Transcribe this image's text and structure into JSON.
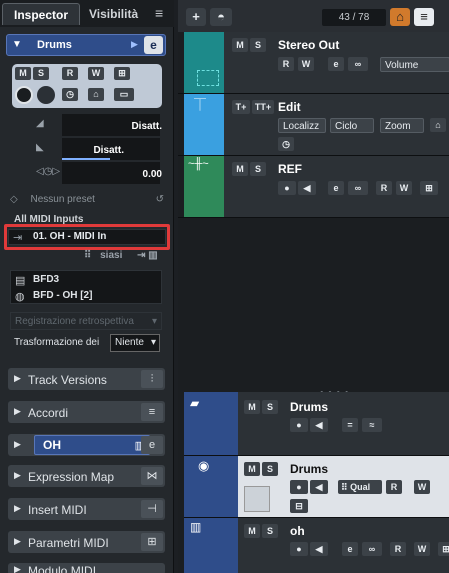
{
  "inspector": {
    "tab_inspector": "Inspector",
    "tab_visibility": "Visibilità",
    "menu_icon": "≡",
    "track_name": "Drums",
    "fader_left_value": "Disatt.",
    "fader_pan_value": "Disatt.",
    "fader_delay_value": "0.00",
    "preset": "Nessun preset",
    "midi_input": "All MIDI Inputs",
    "midi_output": "01. OH - MIDI In",
    "siasi": "siasi",
    "instrument": "BFD3",
    "instrument_program": "BFD - OH [2]",
    "retro_record": "Registrazione retrospettiva",
    "transform_label": "Trasformazione dei",
    "transform_value": "Niente",
    "sections": {
      "track_versions": "Track Versions",
      "chords": "Accordi",
      "oh_label": "OH",
      "expression_map": "Expression Map",
      "insert_midi": "Insert MIDI",
      "midi_params": "Parametri MIDI",
      "last": "Modulo MIDI"
    }
  },
  "project": {
    "counter": "43 / 78",
    "tracks": [
      {
        "name": "Stereo Out",
        "field": "Volume",
        "color": "#1d8a8a"
      },
      {
        "name": "Edit",
        "fields": [
          "Localizz",
          "Ciclo",
          "Zoom"
        ],
        "color": "#3aa0e0"
      },
      {
        "name": "REF",
        "color": "#2f8a5a"
      }
    ],
    "lower_tracks": [
      {
        "name": "Drums"
      },
      {
        "name": "Drums",
        "quality": "Qual"
      },
      {
        "name": "oh"
      }
    ]
  },
  "colors": {
    "accent_blue": "#2f4d8a",
    "highlight_red": "#e03a3a",
    "orange": "#d17a2c"
  }
}
